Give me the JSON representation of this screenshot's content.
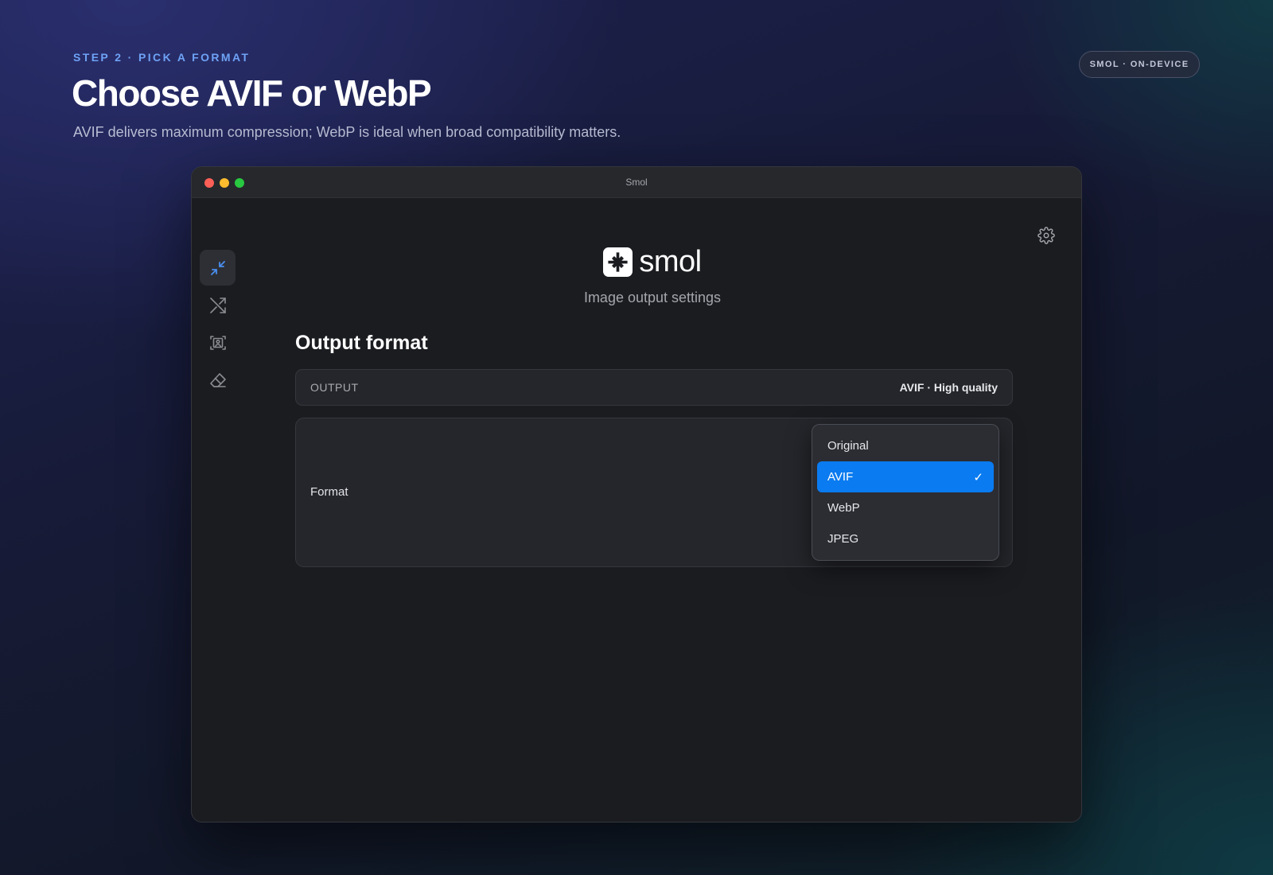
{
  "hero": {
    "eyebrow": "STEP 2 · PICK A FORMAT",
    "title": "Choose AVIF or WebP",
    "subtitle": "AVIF delivers maximum compression; WebP is ideal when broad compatibility matters.",
    "badge": "SMOL · ON-DEVICE"
  },
  "window": {
    "title": "Smol"
  },
  "sidebar": {
    "items": [
      {
        "icon": "compress-icon",
        "active": true
      },
      {
        "icon": "shuffle-icon",
        "active": false
      },
      {
        "icon": "image-scan-icon",
        "active": false
      },
      {
        "icon": "eraser-icon",
        "active": false
      }
    ]
  },
  "app": {
    "brand": "smol",
    "subtitle": "Image output settings",
    "settings_icon": "gear-icon"
  },
  "main": {
    "section_title": "Output format",
    "output_label": "OUTPUT",
    "output_value": "AVIF · High quality",
    "format_label": "Format",
    "format_options": [
      "Original",
      "AVIF",
      "WebP",
      "JPEG"
    ],
    "selected_option": "AVIF",
    "check_mark": "✓"
  },
  "colors": {
    "accent": "#0a7bf0",
    "eyebrow": "#6ea2f5",
    "active_icon": "#4a8ff0"
  }
}
